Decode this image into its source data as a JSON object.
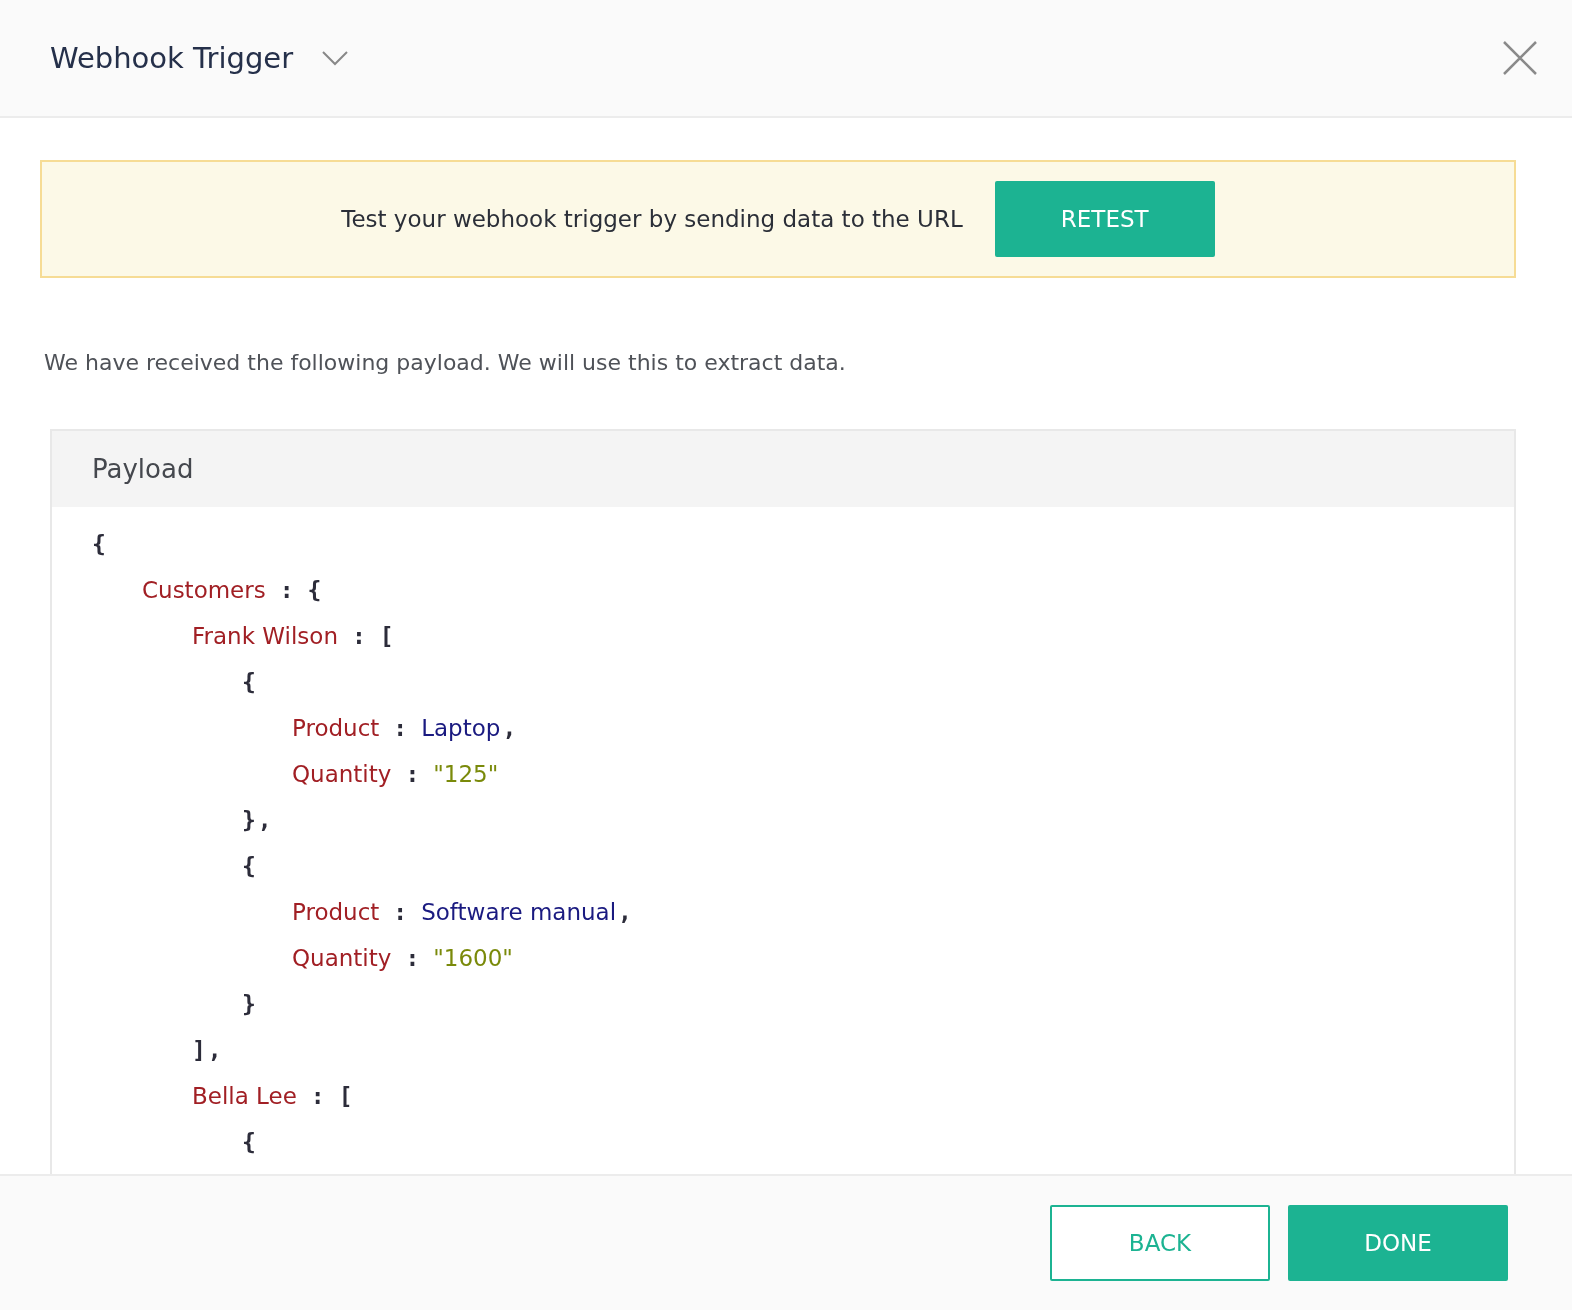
{
  "header": {
    "title": "Webhook Trigger"
  },
  "banner": {
    "message": "Test your webhook trigger by sending data to the URL",
    "button": "RETEST"
  },
  "intro": "We have received the following payload. We will use this to extract data.",
  "payload": {
    "title": "Payload",
    "lines": [
      {
        "tokens": [
          {
            "kind": "punct",
            "text": "{"
          }
        ],
        "children": [
          {
            "tokens": [
              {
                "kind": "key",
                "text": "Customers"
              },
              {
                "kind": "punct",
                "text": ":"
              },
              {
                "kind": "punct",
                "text": "{"
              }
            ],
            "children": [
              {
                "tokens": [
                  {
                    "kind": "key",
                    "text": "Frank Wilson"
                  },
                  {
                    "kind": "punct",
                    "text": ":"
                  },
                  {
                    "kind": "punct",
                    "text": "["
                  }
                ],
                "children": [
                  {
                    "tokens": [
                      {
                        "kind": "punct",
                        "text": "{"
                      }
                    ],
                    "children": [
                      {
                        "tokens": [
                          {
                            "kind": "key",
                            "text": "Product"
                          },
                          {
                            "kind": "punct",
                            "text": ":"
                          },
                          {
                            "kind": "value",
                            "text": "Laptop"
                          },
                          {
                            "kind": "comma",
                            "text": ","
                          }
                        ]
                      },
                      {
                        "tokens": [
                          {
                            "kind": "key",
                            "text": "Quantity"
                          },
                          {
                            "kind": "punct",
                            "text": ":"
                          },
                          {
                            "kind": "quoted",
                            "text": "\"125\""
                          }
                        ]
                      }
                    ]
                  },
                  {
                    "tokens": [
                      {
                        "kind": "punct",
                        "text": "}"
                      },
                      {
                        "kind": "comma",
                        "text": ","
                      }
                    ]
                  },
                  {
                    "tokens": [
                      {
                        "kind": "punct",
                        "text": "{"
                      }
                    ],
                    "children": [
                      {
                        "tokens": [
                          {
                            "kind": "key",
                            "text": "Product"
                          },
                          {
                            "kind": "punct",
                            "text": ":"
                          },
                          {
                            "kind": "value",
                            "text": "Software manual"
                          },
                          {
                            "kind": "comma",
                            "text": ","
                          }
                        ]
                      },
                      {
                        "tokens": [
                          {
                            "kind": "key",
                            "text": "Quantity"
                          },
                          {
                            "kind": "punct",
                            "text": ":"
                          },
                          {
                            "kind": "quoted",
                            "text": "\"1600\""
                          }
                        ]
                      }
                    ]
                  },
                  {
                    "tokens": [
                      {
                        "kind": "punct",
                        "text": "}"
                      }
                    ]
                  }
                ]
              },
              {
                "tokens": [
                  {
                    "kind": "punct",
                    "text": "]"
                  },
                  {
                    "kind": "comma",
                    "text": ","
                  }
                ]
              },
              {
                "tokens": [
                  {
                    "kind": "key",
                    "text": "Bella Lee"
                  },
                  {
                    "kind": "punct",
                    "text": ":"
                  },
                  {
                    "kind": "punct",
                    "text": "["
                  }
                ],
                "children": [
                  {
                    "tokens": [
                      {
                        "kind": "punct",
                        "text": "{"
                      }
                    ]
                  }
                ]
              }
            ]
          }
        ]
      }
    ]
  },
  "footer": {
    "buttons": [
      {
        "label": "BACK",
        "kind": "secondary"
      },
      {
        "label": "DONE",
        "kind": "primary"
      }
    ]
  }
}
